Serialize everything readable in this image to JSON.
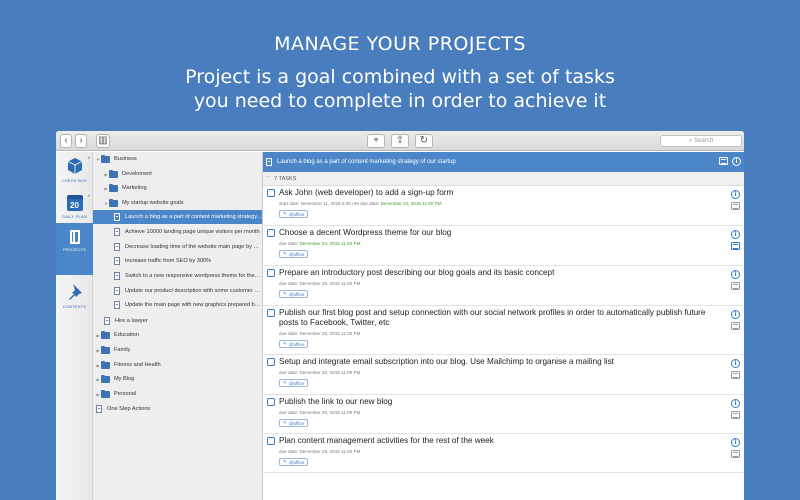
{
  "hero": {
    "title": "MANAGE YOUR PROJECTS",
    "subtitle_line1": "Project is a goal combined with a set of tasks",
    "subtitle_line2": "you need to complete in order to achieve it"
  },
  "toolbar": {
    "back_glyph": "‹",
    "forward_glyph": "›",
    "sidebar_toggle_glyph": "▥",
    "add_glyph": "+",
    "share_glyph": "⇪",
    "sync_glyph": "↻",
    "search_placeholder": "Search",
    "search_icon_glyph": "⌕"
  },
  "nav": {
    "items": [
      {
        "label": "Check box",
        "icon": "check-box-icon",
        "badge": "8"
      },
      {
        "label": "Daily plan",
        "icon": "calendar-icon",
        "day": "20",
        "badge": "8"
      },
      {
        "label": "Projects",
        "icon": "projects-icon",
        "active": true
      },
      {
        "label": "Contexts",
        "icon": "pin-icon"
      }
    ]
  },
  "tree": {
    "rows": [
      {
        "label": "Business",
        "type": "folder",
        "expanded": true
      },
      {
        "label": "Develoment",
        "type": "folder"
      },
      {
        "label": "Marketing",
        "type": "folder"
      },
      {
        "label": "My startup website goals",
        "type": "folder",
        "expanded": true
      },
      {
        "label": "Launch a blog as a part of content marketing strategy of our startup",
        "type": "project",
        "selected": true
      },
      {
        "label": "Achieve 10000 landing page unique visitors per month",
        "type": "project"
      },
      {
        "label": "Decrease loading time of the website main page by 50%",
        "type": "project"
      },
      {
        "label": "Increase traffic from SEO by 300%",
        "type": "project"
      },
      {
        "label": "Switch to a new responsive wordpress theme for the website",
        "type": "project"
      },
      {
        "label": "Update our product description with some customer stories",
        "type": "project"
      },
      {
        "label": "Update the main page with new graphics prepared by designers",
        "type": "project"
      },
      {
        "label": "Hire a lawyer",
        "type": "project"
      },
      {
        "label": "Education",
        "type": "folder"
      },
      {
        "label": "Family",
        "type": "folder"
      },
      {
        "label": "Fitness and Health",
        "type": "folder"
      },
      {
        "label": "My Blog",
        "type": "folder"
      },
      {
        "label": "Personal",
        "type": "folder"
      },
      {
        "label": "One Step Actions",
        "type": "project"
      }
    ]
  },
  "project": {
    "title": "Launch a blog as a part of content marketing strategy of our startup",
    "task_count": "7 TASKS"
  },
  "tasks": [
    {
      "title": "Ask John (web developer) to add a sign-up form",
      "start_label": "start date:",
      "start": "November 11, 2015 8:00 AM",
      "due_label": "due date:",
      "due": "December 24, 2015 11:50 PM",
      "due_green": true,
      "tag": "@office"
    },
    {
      "title": "Choose a decent Wordpress theme for our blog",
      "due_label": "due date:",
      "due": "December 24, 2015 11:50 PM",
      "due_green": true,
      "tag": "@office",
      "note_blue": true
    },
    {
      "title": "Prepare an introductory post describing our blog goals and its basic concept",
      "due_label": "due date:",
      "due": "December 25, 2015 11:00 PM",
      "tag": "@office"
    },
    {
      "title": "Publish our first blog post and setup connection with our social network profiles in order to automatically publish future posts to Facebook, Twitter, etc",
      "due_label": "due date:",
      "due": "December 25, 2015 11:00 PM",
      "tag": "@office"
    },
    {
      "title": "Setup and integrate email subscription into our blog. Use Mailchimp to organise a mailing list",
      "due_label": "due date:",
      "due": "December 25, 2015 11:00 PM",
      "tag": "@office"
    },
    {
      "title": "Publish the link to our new blog",
      "due_label": "due date:",
      "due": "December 26, 2015 11:00 PM",
      "tag": "@office"
    },
    {
      "title": "Plan content management activities for the rest of the week",
      "due_label": "due date:",
      "due": "December 28, 2015 11:00 PM",
      "tag": "@office"
    }
  ],
  "colors": {
    "accent": "#4a86c8",
    "background": "#4a7dbd",
    "due_green": "#3d9a28"
  }
}
